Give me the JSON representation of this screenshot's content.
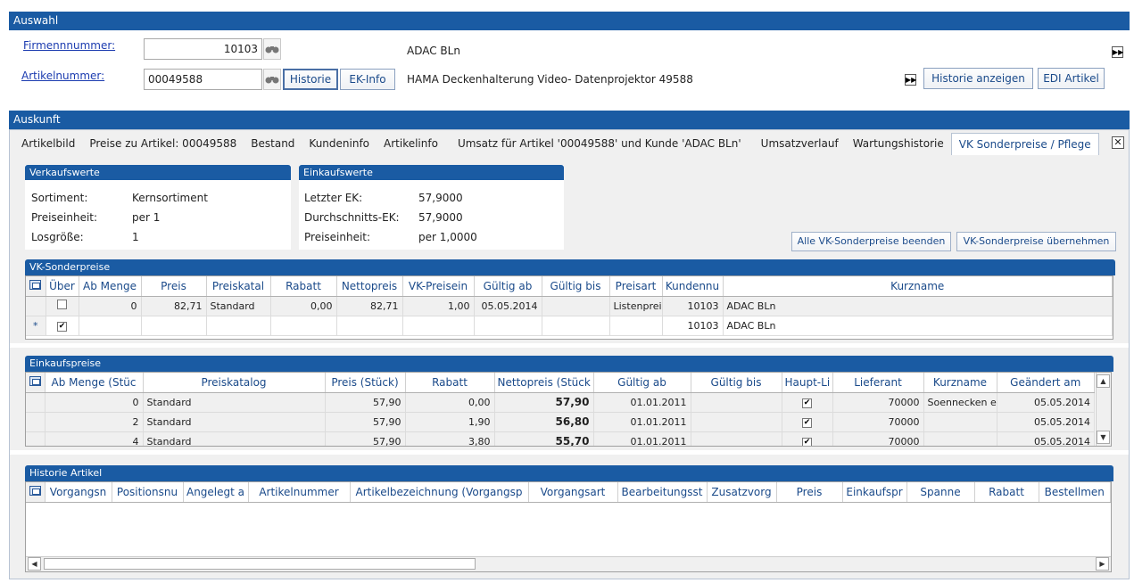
{
  "auswahl": {
    "title": "Auswahl",
    "firma_label": "Firmennnummer:",
    "firma_value": "10103",
    "firma_name": "ADAC BLn",
    "artikel_label": "Artikelnummer:",
    "artikel_value": "00049588",
    "artikel_name": "HAMA Deckenhalterung Video- Datenprojektor 49588",
    "historie_btn": "Historie",
    "ekinfo_btn": "EK-Info",
    "historie_anzeigen_btn": "Historie anzeigen",
    "edi_btn": "EDI Artikel"
  },
  "auskunft": {
    "title": "Auskunft",
    "tabs": [
      "Artikelbild",
      "Preise zu Artikel: 00049588",
      "Bestand",
      "Kundeninfo",
      "Artikelinfo",
      "Umsatz für Artikel '00049588' und Kunde 'ADAC BLn'",
      "Umsatzverlauf",
      "Wartungshistorie",
      "VK Sonderpreise / Pflege"
    ]
  },
  "verkaufswerte": {
    "title": "Verkaufswerte",
    "rows": [
      {
        "label": "Sortiment:",
        "value": "Kernsortiment"
      },
      {
        "label": "Preiseinheit:",
        "value": "per 1"
      },
      {
        "label": "Losgröße:",
        "value": "1"
      }
    ]
  },
  "einkaufswerte": {
    "title": "Einkaufswerte",
    "rows": [
      {
        "label": "Letzter EK:",
        "value": "57,9000"
      },
      {
        "label": "Durchschnitts-EK:",
        "value": "57,9000"
      },
      {
        "label": "Preiseinheit:",
        "value": "per 1,0000"
      }
    ]
  },
  "buttons": {
    "beenden": "Alle VK-Sonderpreise beenden",
    "uebernehmen": "VK-Sonderpreise übernehmen"
  },
  "vk_grid": {
    "title": "VK-Sonderpreise",
    "columns": [
      "Über",
      "Ab Menge",
      "Preis",
      "Preiskatal",
      "Rabatt",
      "Nettopreis",
      "VK-Preisein",
      "Gültig ab",
      "Gültig bis",
      "Preisart",
      "Kundennu",
      "Kurzname"
    ],
    "row1": [
      "",
      "0",
      "82,71",
      "Standard",
      "0,00",
      "82,71",
      "1,00",
      "05.05.2014",
      "",
      "Listenprei",
      "10103",
      "ADAC BLn"
    ],
    "row1_checked": false,
    "newrow_marker": "*",
    "row2": [
      "",
      "",
      "",
      "",
      "",
      "",
      "",
      "",
      "",
      "",
      "10103",
      "ADAC BLn"
    ],
    "row2_checked": true
  },
  "ek_grid": {
    "title": "Einkaufspreise",
    "columns": [
      "Ab Menge (Stüc",
      "Preiskatalog",
      "Preis (Stück)",
      "Rabatt",
      "Nettopreis (Stück",
      "Gültig ab",
      "Gültig bis",
      "Haupt-Li",
      "Lieferant",
      "Kurzname",
      "Geändert am"
    ],
    "rows": [
      [
        "0",
        "Standard",
        "57,90",
        "0,00",
        "57,90",
        "01.01.2011",
        "",
        "",
        "70000",
        "Soennecken e",
        "05.05.2014"
      ],
      [
        "2",
        "Standard",
        "57,90",
        "1,90",
        "56,80",
        "01.01.2011",
        "",
        "",
        "70000",
        "",
        "05.05.2014"
      ],
      [
        "4",
        "Standard",
        "57,90",
        "3,80",
        "55,70",
        "01.01.2011",
        "",
        "",
        "70000",
        "",
        "05.05.2014"
      ]
    ]
  },
  "hist_grid": {
    "title": "Historie Artikel",
    "columns": [
      "Vorgangsn",
      "Positionsnu",
      "Angelegt a",
      "Artikelnummer",
      "Artikelbezeichnung (Vorgangsp",
      "Vorgangsart",
      "Bearbeitungsst",
      "Zusatzvorg",
      "Preis",
      "Einkaufspr",
      "Spanne",
      "Rabatt",
      "Bestellmen"
    ]
  },
  "colors": {
    "header_blue": "#1a5ba3",
    "link": "#1c3cb0",
    "column_text": "#1a4a8a"
  }
}
